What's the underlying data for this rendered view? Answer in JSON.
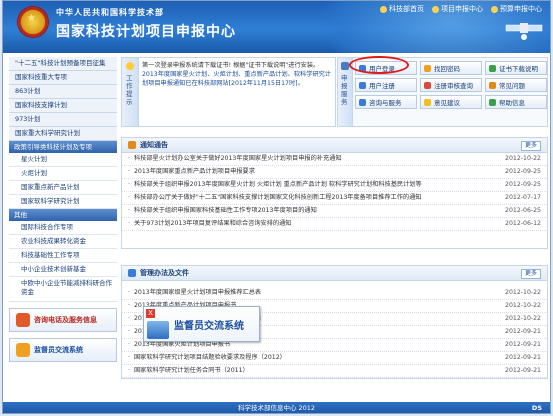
{
  "header": {
    "ministry": "中华人民共和国科学技术部",
    "title": "国家科技计划项目申报中心",
    "links": [
      "科技部首页",
      "项目申报中心",
      "预算申报中心"
    ]
  },
  "sidebar": {
    "top_items": [
      "\"十二五\"科技计划预备项目征集",
      "国家科技重大专项",
      "863计划",
      "国家科技支撑计划",
      "973计划",
      "国家重大科学研究计划"
    ],
    "group1": "政策引导类科技计划及专项",
    "group1_items": [
      "星火计划",
      "火炬计划",
      "国家重点新产品计划",
      "国家软科学研究计划"
    ],
    "group2": "其他",
    "group2_items": [
      "国际科技合作专项",
      "农业科技成果转化资金",
      "科技基础性工作专项",
      "中小企业技术创新基金"
    ],
    "group2_multi": "中欧中小企业节能减排科研合作资金",
    "btn1": "咨询电话及服务信息",
    "btn2": "监督员交流系统"
  },
  "notice": {
    "tab": "工作提示",
    "lines": [
      "第一次登录申报系统请下载证书! 根据\"证书下载说明\"进行安装。",
      "2013年度国家星火计划、火炬计划、重点新产品计划、软科学研究计划项目申报通知已在科技部网站[2012年11月15日17时]。"
    ]
  },
  "services": {
    "tab": "申报服务",
    "buttons": [
      "用户登录",
      "找回密码",
      "证书下载说明",
      "用户注册",
      "注册审核查询",
      "常见问题",
      "咨询与服务",
      "意见建议",
      "帮助信息"
    ]
  },
  "notices_panel": {
    "title": "通知通告",
    "more": "更多",
    "rows": [
      {
        "title": "科技部星火计划办公室关于做好2013年度国家星火计划项目申报的补充通知",
        "date": "2012-10-22"
      },
      {
        "title": "2013年度国家重点新产品计划项目申报要求",
        "date": "2012-09-25"
      },
      {
        "title": "科技部关于组织申报2013年度国家星火计划 火炬计划 重点新产品计划 软科学研究计划和科技基民计划等",
        "date": "2012-09-25"
      },
      {
        "title": "科技部办公厅关于做好\"十二五\"国家科技支撑计划国家文化科技创新工程2013年度备项目推荐工作的通知",
        "date": "2012-07-17"
      },
      {
        "title": "科技部关于组织申报国家科技基础性工作专项2013年度项目的通知",
        "date": "2012-06-25"
      },
      {
        "title": "关于973计划2013年项目复评结果和综合咨询安排的通知",
        "date": "2012-06-12"
      }
    ]
  },
  "regs_panel": {
    "title": "管理办法及文件",
    "more": "更多",
    "rows": [
      {
        "title": "2013年度国家级星火计划项目申报推荐汇总表",
        "date": "2012-10-22"
      },
      {
        "title": "2013年度重点新产品计划项目申报书",
        "date": "2012-10-22"
      },
      {
        "title": "2013年度国家软科学研究计划项目专家意见表",
        "date": "2012-10-22"
      },
      {
        "title": "2013年度国家软科学研究计划项目申报书",
        "date": "2012-09-21"
      },
      {
        "title": "2013年度国家火炬计划项目申报书",
        "date": "2012-09-21"
      },
      {
        "title": "国家软科学研究计划项目结题验收要求及程序（2012）",
        "date": "2012-09-21"
      },
      {
        "title": "国家软科学研究计划任务合同书（2011）",
        "date": "2012-09-21"
      }
    ]
  },
  "popup": {
    "text": "监督员交流系统",
    "close": "X"
  },
  "footer": {
    "text": "科学技术部信息中心 2012",
    "dd": "DS"
  }
}
